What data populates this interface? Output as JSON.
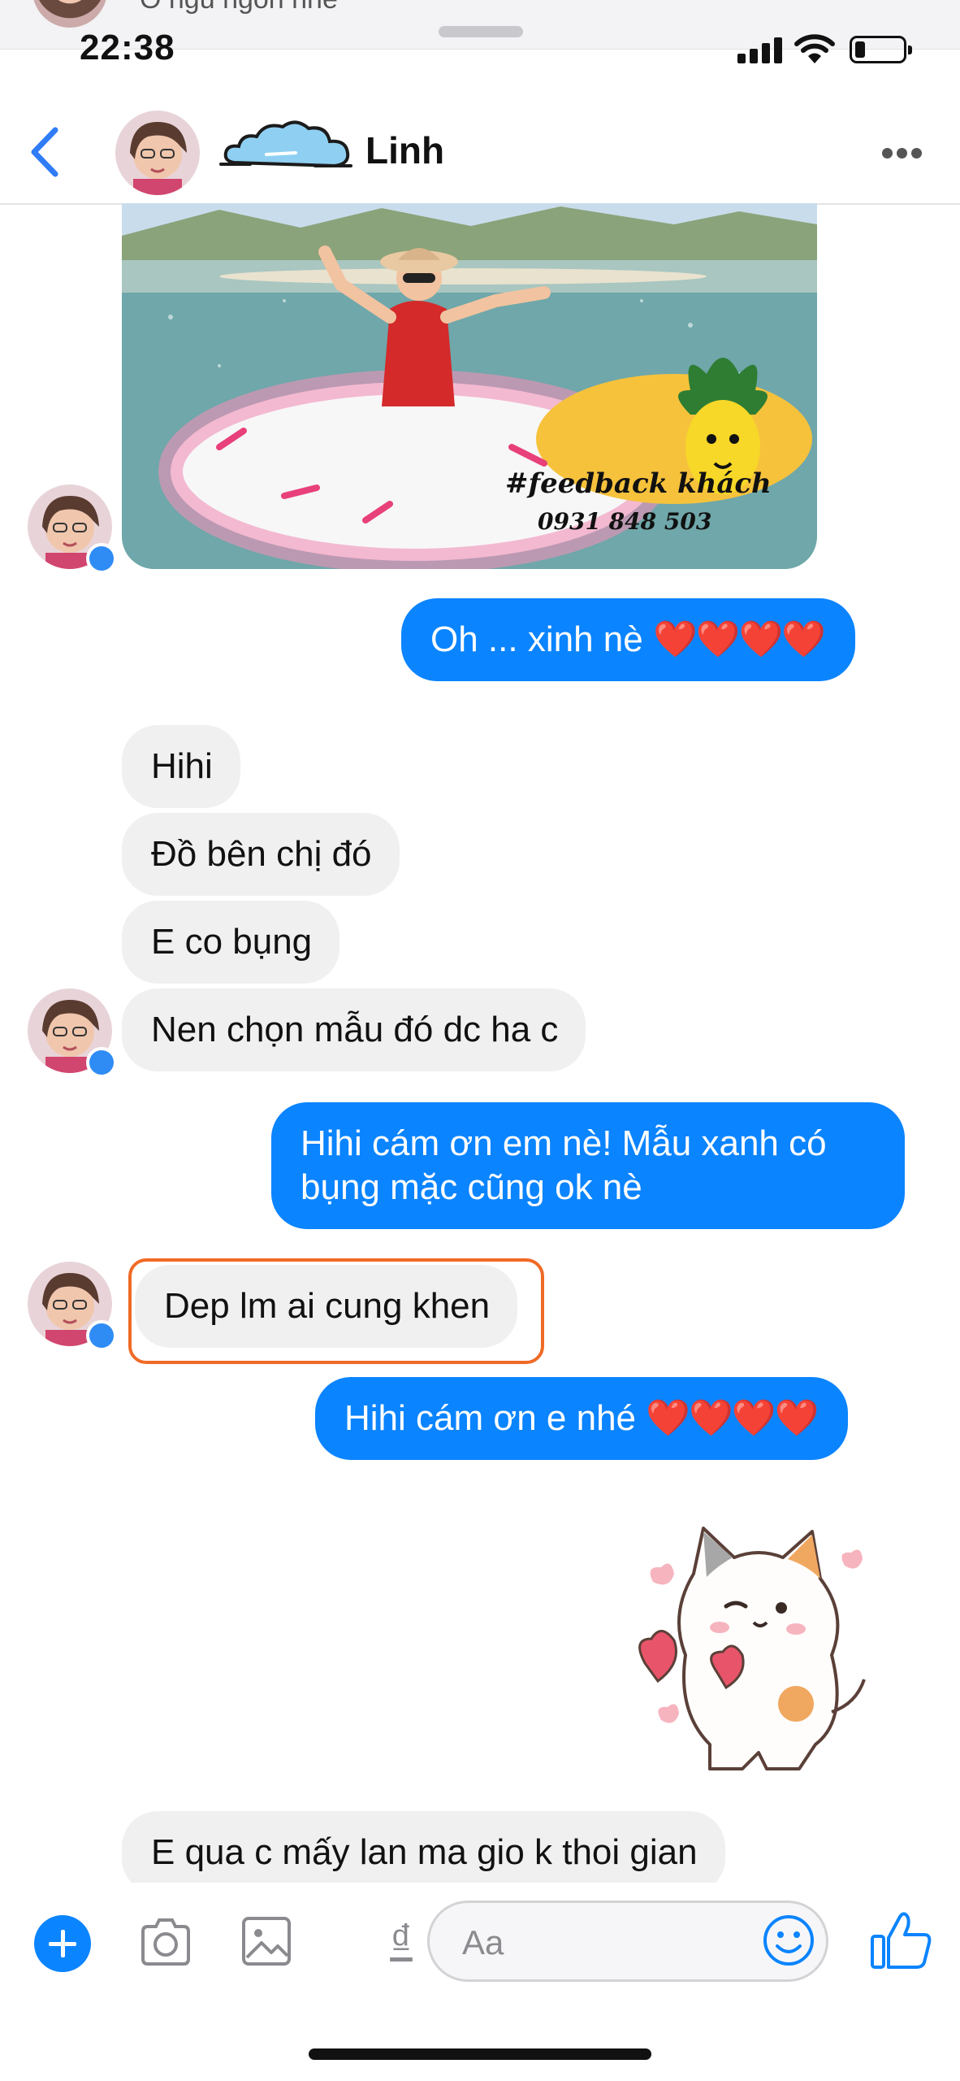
{
  "notification": {
    "text": "Ô ngủ ngon nhé"
  },
  "status_bar": {
    "time": "22:38"
  },
  "header": {
    "contact_name": "Linh"
  },
  "photo_message": {
    "watermark_tag": "#feedback khách",
    "watermark_phone": "0931 848 503"
  },
  "messages": {
    "m1": {
      "side": "out",
      "text": "Oh ... xinh nè",
      "hearts": "❤️❤️❤️❤️"
    },
    "m2": {
      "side": "in",
      "text": "Hihi"
    },
    "m3": {
      "side": "in",
      "text": "Đồ bên chị đó"
    },
    "m4": {
      "side": "in",
      "text": "E co bụng"
    },
    "m5": {
      "side": "in",
      "text": "Nen chọn mẫu đó dc ha c"
    },
    "m6": {
      "side": "out",
      "line1": "Hihi cám ơn em nè! Mẫu xanh có",
      "line2": "bụng mặc cũng ok nè"
    },
    "m7": {
      "side": "in",
      "text": "Dep lm ai cung khen",
      "highlighted": true
    },
    "m8": {
      "side": "out",
      "text": "Hihi cám ơn e nhé",
      "hearts": "❤️❤️❤️❤️"
    },
    "m9": {
      "side": "in",
      "text": "E qua c mấy lan ma gio k thoi gian"
    }
  },
  "composer": {
    "placeholder": "Aa",
    "currency_symbol": "₫"
  },
  "colors": {
    "accent": "#0b84ff",
    "incoming_bubble": "#f0f0f0",
    "highlight": "#f06a26"
  },
  "icons": [
    "back-chevron-icon",
    "more-icon",
    "plus-icon",
    "camera-icon",
    "image-icon",
    "dong-icon",
    "emoji-icon",
    "thumbs-up-icon",
    "messenger-badge-icon"
  ]
}
